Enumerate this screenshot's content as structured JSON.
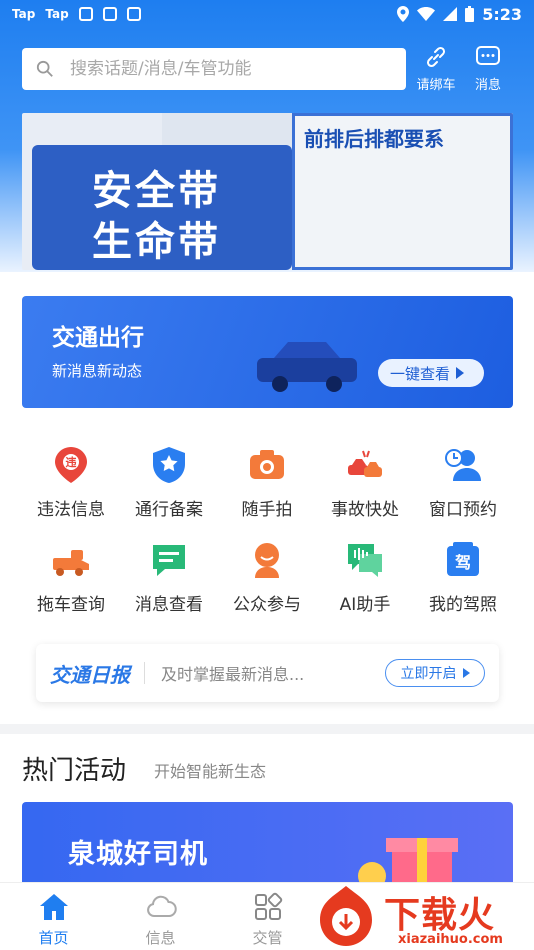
{
  "status_bar": {
    "left_icons": [
      "taptap-icon",
      "taptap-icon",
      "feather-icon",
      "calendar-icon",
      "a-icon"
    ],
    "right_icons": [
      "location-icon",
      "wifi-icon",
      "signal-icon",
      "battery-icon"
    ],
    "time": "5:23"
  },
  "header": {
    "search_placeholder": "搜索话题/消息/车管功能",
    "bind_car_label": "请绑车",
    "messages_label": "消息"
  },
  "safety_banner": {
    "line1": "安全带",
    "line2": "生命带",
    "right_title": "前排后排都要系"
  },
  "news_banner": {
    "title": "交通出行",
    "subtitle": "新消息新动态",
    "button": "一键查看"
  },
  "features": [
    {
      "label": "违法信息",
      "icon": "violation-icon",
      "color": "#e8463b"
    },
    {
      "label": "通行备案",
      "icon": "shield-star-icon",
      "color": "#2a7ef0"
    },
    {
      "label": "随手拍",
      "icon": "camera-icon",
      "color": "#f37a3a"
    },
    {
      "label": "事故快处",
      "icon": "car-crash-icon",
      "color": "#e8463b"
    },
    {
      "label": "窗口预约",
      "icon": "user-clock-icon",
      "color": "#2a7ef0"
    },
    {
      "label": "拖车查询",
      "icon": "tow-truck-icon",
      "color": "#f37a3a"
    },
    {
      "label": "消息查看",
      "icon": "message-icon",
      "color": "#28b978"
    },
    {
      "label": "公众参与",
      "icon": "person-icon",
      "color": "#f37a3a"
    },
    {
      "label": "AI助手",
      "icon": "ai-chat-icon",
      "color": "#28b978"
    },
    {
      "label": "我的驾照",
      "icon": "license-icon",
      "color": "#2a7ef0"
    }
  ],
  "daily": {
    "logo": "交通日报",
    "text": "及时掌握最新消息...",
    "button": "立即开启"
  },
  "hot": {
    "title": "热门活动",
    "subtitle": "开始智能新生态",
    "promo_title": "泉城好司机"
  },
  "tabs": [
    {
      "label": "首页",
      "active": true
    },
    {
      "label": "信息",
      "active": false
    },
    {
      "label": "交管",
      "active": false
    }
  ],
  "watermark": {
    "text": "下载火",
    "url": "xiazaihuo.com"
  }
}
